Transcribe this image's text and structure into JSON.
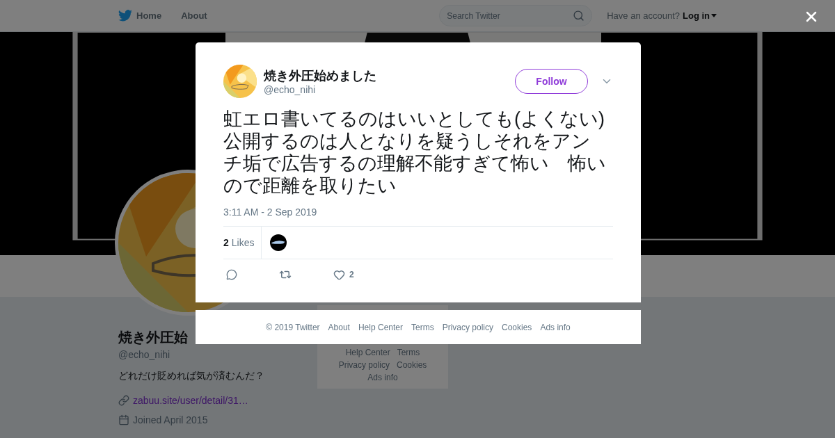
{
  "nav": {
    "items": [
      {
        "label": "Home"
      },
      {
        "label": "About"
      }
    ],
    "search": {
      "placeholder": "Search Twitter"
    },
    "account": {
      "prompt": "Have an account?",
      "login": "Log in"
    }
  },
  "profile": {
    "name": "焼き外圧始",
    "handle": "@echo_nihi",
    "bio": "どれだけ貶めれば気が済むんだ？",
    "link": "zabuu.site/user/detail/31…",
    "joined": "Joined April 2015"
  },
  "page_footer": {
    "links": [
      "Help Center",
      "Terms",
      "Privacy policy",
      "Cookies",
      "Ads info"
    ]
  },
  "tweet": {
    "author": {
      "name": "焼き外圧始めました",
      "handle": "@echo_nihi"
    },
    "follow": "Follow",
    "text": "虹エロ書いてるのはいいとしても(よくない)公開するのは人となりを疑うしそれをアンチ垢で広告するの理解不能すぎて怖い　怖いので距離を取りたい",
    "time": "3:11 AM - 2 Sep 2019",
    "likes": {
      "count": "2",
      "label": "Likes"
    },
    "like_count": "2"
  },
  "modal_footer": {
    "links": [
      "© 2019 Twitter",
      "About",
      "Help Center",
      "Terms",
      "Privacy policy",
      "Cookies",
      "Ads info"
    ]
  }
}
